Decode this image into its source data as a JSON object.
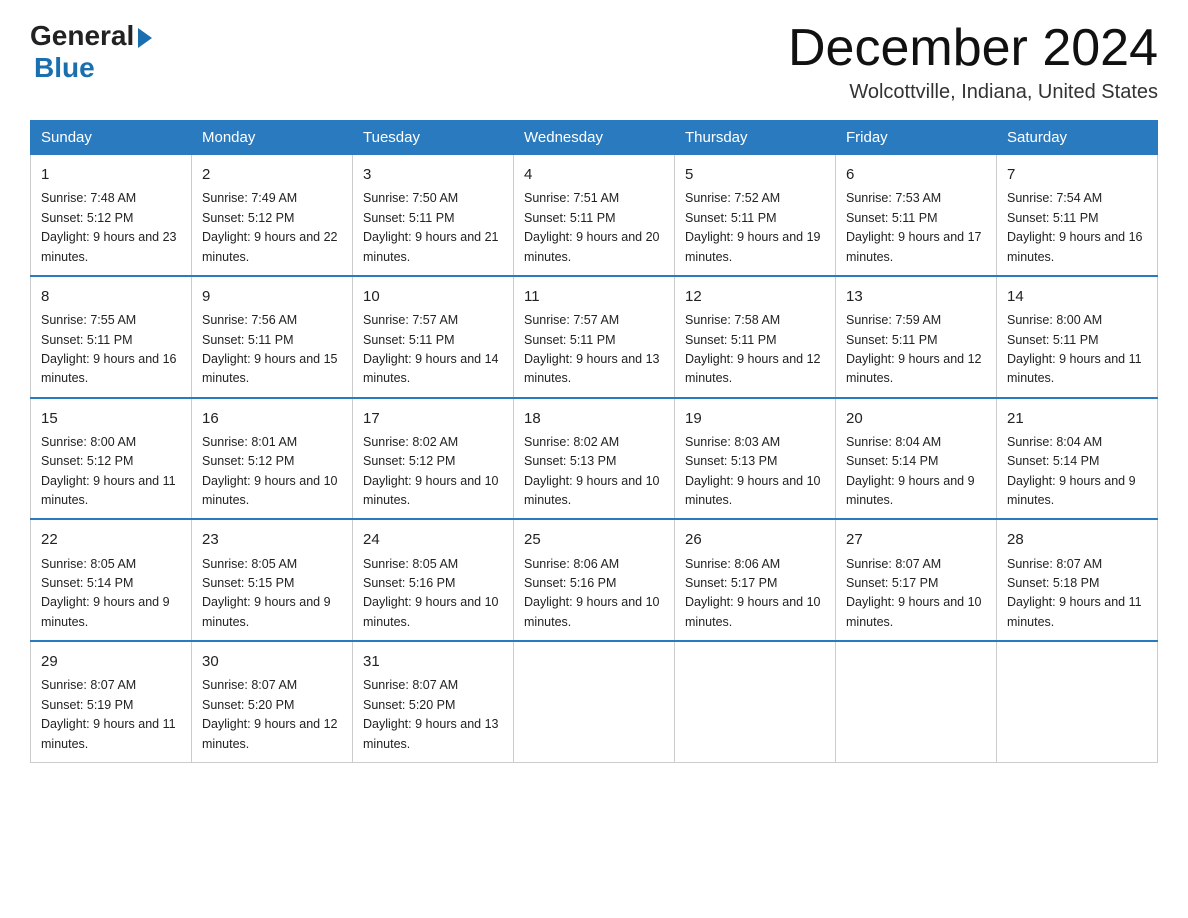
{
  "header": {
    "logo_general": "General",
    "logo_blue": "Blue",
    "month_title": "December 2024",
    "location": "Wolcottville, Indiana, United States"
  },
  "days_of_week": [
    "Sunday",
    "Monday",
    "Tuesday",
    "Wednesday",
    "Thursday",
    "Friday",
    "Saturday"
  ],
  "weeks": [
    [
      {
        "day": 1,
        "sunrise": "7:48 AM",
        "sunset": "5:12 PM",
        "daylight": "9 hours and 23 minutes."
      },
      {
        "day": 2,
        "sunrise": "7:49 AM",
        "sunset": "5:12 PM",
        "daylight": "9 hours and 22 minutes."
      },
      {
        "day": 3,
        "sunrise": "7:50 AM",
        "sunset": "5:11 PM",
        "daylight": "9 hours and 21 minutes."
      },
      {
        "day": 4,
        "sunrise": "7:51 AM",
        "sunset": "5:11 PM",
        "daylight": "9 hours and 20 minutes."
      },
      {
        "day": 5,
        "sunrise": "7:52 AM",
        "sunset": "5:11 PM",
        "daylight": "9 hours and 19 minutes."
      },
      {
        "day": 6,
        "sunrise": "7:53 AM",
        "sunset": "5:11 PM",
        "daylight": "9 hours and 17 minutes."
      },
      {
        "day": 7,
        "sunrise": "7:54 AM",
        "sunset": "5:11 PM",
        "daylight": "9 hours and 16 minutes."
      }
    ],
    [
      {
        "day": 8,
        "sunrise": "7:55 AM",
        "sunset": "5:11 PM",
        "daylight": "9 hours and 16 minutes."
      },
      {
        "day": 9,
        "sunrise": "7:56 AM",
        "sunset": "5:11 PM",
        "daylight": "9 hours and 15 minutes."
      },
      {
        "day": 10,
        "sunrise": "7:57 AM",
        "sunset": "5:11 PM",
        "daylight": "9 hours and 14 minutes."
      },
      {
        "day": 11,
        "sunrise": "7:57 AM",
        "sunset": "5:11 PM",
        "daylight": "9 hours and 13 minutes."
      },
      {
        "day": 12,
        "sunrise": "7:58 AM",
        "sunset": "5:11 PM",
        "daylight": "9 hours and 12 minutes."
      },
      {
        "day": 13,
        "sunrise": "7:59 AM",
        "sunset": "5:11 PM",
        "daylight": "9 hours and 12 minutes."
      },
      {
        "day": 14,
        "sunrise": "8:00 AM",
        "sunset": "5:11 PM",
        "daylight": "9 hours and 11 minutes."
      }
    ],
    [
      {
        "day": 15,
        "sunrise": "8:00 AM",
        "sunset": "5:12 PM",
        "daylight": "9 hours and 11 minutes."
      },
      {
        "day": 16,
        "sunrise": "8:01 AM",
        "sunset": "5:12 PM",
        "daylight": "9 hours and 10 minutes."
      },
      {
        "day": 17,
        "sunrise": "8:02 AM",
        "sunset": "5:12 PM",
        "daylight": "9 hours and 10 minutes."
      },
      {
        "day": 18,
        "sunrise": "8:02 AM",
        "sunset": "5:13 PM",
        "daylight": "9 hours and 10 minutes."
      },
      {
        "day": 19,
        "sunrise": "8:03 AM",
        "sunset": "5:13 PM",
        "daylight": "9 hours and 10 minutes."
      },
      {
        "day": 20,
        "sunrise": "8:04 AM",
        "sunset": "5:14 PM",
        "daylight": "9 hours and 9 minutes."
      },
      {
        "day": 21,
        "sunrise": "8:04 AM",
        "sunset": "5:14 PM",
        "daylight": "9 hours and 9 minutes."
      }
    ],
    [
      {
        "day": 22,
        "sunrise": "8:05 AM",
        "sunset": "5:14 PM",
        "daylight": "9 hours and 9 minutes."
      },
      {
        "day": 23,
        "sunrise": "8:05 AM",
        "sunset": "5:15 PM",
        "daylight": "9 hours and 9 minutes."
      },
      {
        "day": 24,
        "sunrise": "8:05 AM",
        "sunset": "5:16 PM",
        "daylight": "9 hours and 10 minutes."
      },
      {
        "day": 25,
        "sunrise": "8:06 AM",
        "sunset": "5:16 PM",
        "daylight": "9 hours and 10 minutes."
      },
      {
        "day": 26,
        "sunrise": "8:06 AM",
        "sunset": "5:17 PM",
        "daylight": "9 hours and 10 minutes."
      },
      {
        "day": 27,
        "sunrise": "8:07 AM",
        "sunset": "5:17 PM",
        "daylight": "9 hours and 10 minutes."
      },
      {
        "day": 28,
        "sunrise": "8:07 AM",
        "sunset": "5:18 PM",
        "daylight": "9 hours and 11 minutes."
      }
    ],
    [
      {
        "day": 29,
        "sunrise": "8:07 AM",
        "sunset": "5:19 PM",
        "daylight": "9 hours and 11 minutes."
      },
      {
        "day": 30,
        "sunrise": "8:07 AM",
        "sunset": "5:20 PM",
        "daylight": "9 hours and 12 minutes."
      },
      {
        "day": 31,
        "sunrise": "8:07 AM",
        "sunset": "5:20 PM",
        "daylight": "9 hours and 13 minutes."
      },
      null,
      null,
      null,
      null
    ]
  ]
}
